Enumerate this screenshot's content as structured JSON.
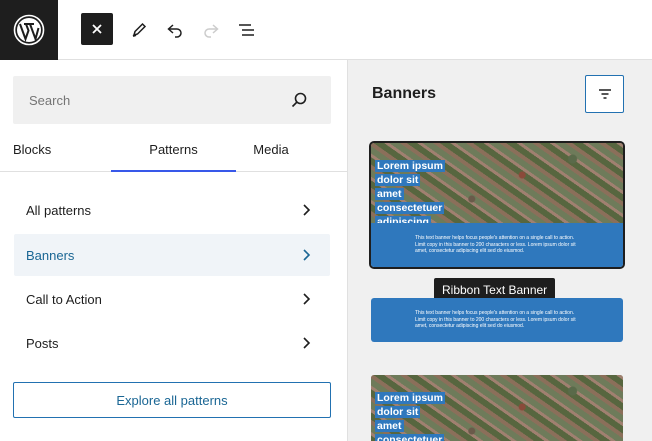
{
  "toolbar": {
    "logo": "wordpress-logo",
    "close_icon": "close-icon",
    "edit_icon": "pencil-icon",
    "undo_icon": "undo-icon",
    "redo_icon": "redo-icon",
    "list_view_icon": "list-view-icon"
  },
  "search": {
    "placeholder": "Search",
    "value": "",
    "icon": "search-icon"
  },
  "tabs": [
    {
      "label": "Blocks"
    },
    {
      "label": "Patterns",
      "active": true
    },
    {
      "label": "Media"
    }
  ],
  "categories": [
    {
      "label": "All patterns"
    },
    {
      "label": "Banners",
      "active": true
    },
    {
      "label": "Call to Action"
    },
    {
      "label": "Posts"
    }
  ],
  "explore_button": "Explore all patterns",
  "preview": {
    "title": "Banners",
    "filter_icon": "filter-icon",
    "tooltip": "Ribbon Text Banner",
    "card_heading": "Lorem ipsum dolor sit amet consectetuer adipiscing",
    "card_body": "This text banner helps focus people's attention on a single call to action. Limit copy in this banner to 200 characters or less. Lorem ipsum dolor sit amet, consectetur adipiscing elit sed do eiusmod."
  },
  "colors": {
    "accent": "#3858e9",
    "link": "#2271b1",
    "banner_blue": "#2f78bd",
    "dark": "#1e1e1e"
  }
}
